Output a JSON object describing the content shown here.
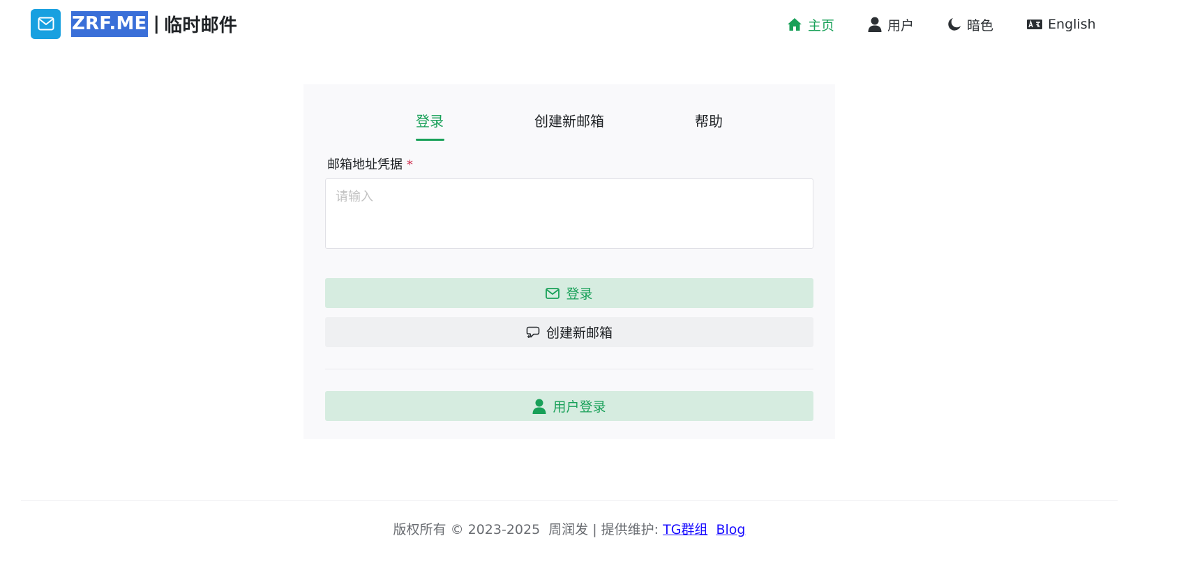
{
  "header": {
    "brand_highlight": "ZRF.ME",
    "brand_separator": "|",
    "brand_title": "临时邮件",
    "nav": [
      {
        "label": "主页",
        "icon": "home-icon",
        "active": true
      },
      {
        "label": "用户",
        "icon": "user-icon",
        "active": false
      },
      {
        "label": "暗色",
        "icon": "moon-icon",
        "active": false
      },
      {
        "label": "English",
        "icon": "language-icon",
        "active": false
      }
    ]
  },
  "card": {
    "tabs": [
      {
        "label": "登录",
        "active": true
      },
      {
        "label": "创建新邮箱",
        "active": false
      },
      {
        "label": "帮助",
        "active": false
      }
    ],
    "field_label": "邮箱地址凭据",
    "field_required_mark": "*",
    "field_placeholder": "请输入",
    "field_value": "",
    "login_button": "登录",
    "create_button": "创建新邮箱",
    "user_login_button": "用户登录"
  },
  "footer": {
    "copyright": "版权所有 © 2023-2025",
    "author": "周润发 | 提供维护:",
    "tg_link": "TG群组",
    "blog_link": "Blog"
  },
  "colors": {
    "accent": "#18a058",
    "brand_logo": "#18a0e0",
    "brand_highlight": "#3a6fd8",
    "link": "#1a0dff"
  }
}
